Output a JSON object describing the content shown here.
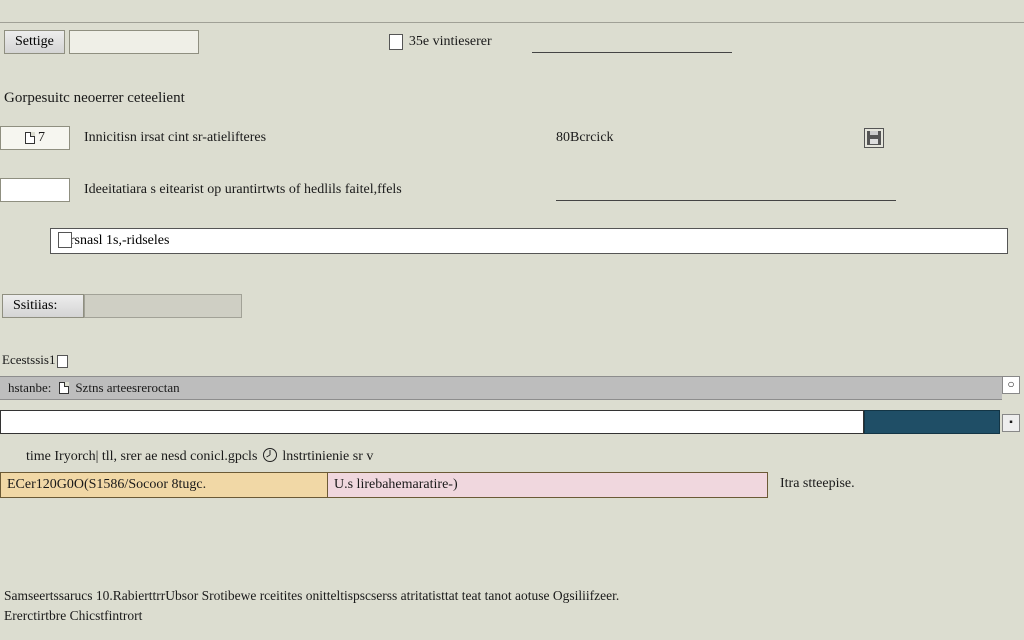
{
  "toolbar": {
    "settings_label": "Settige",
    "view_checkbox_label": "35e vintieserer"
  },
  "section1": {
    "heading": "Gorpesuitc neoerrer ceteelient",
    "row1": {
      "box_value": "7",
      "text": "Innicitisn irsat cint sr-atielifteres",
      "right_label": "80Bcrcick"
    },
    "row2": {
      "text": "Ideeitatiara s eitearist op urantirtwts of hedlils faitel,ffels"
    },
    "row3": {
      "input_value": "farsnasl 1s,-ridseles"
    }
  },
  "section2": {
    "button_label": "Ssitiias:",
    "sub_label": "Ecestssis1",
    "titlebar": {
      "left": "hstanbe:",
      "text": "Sztns arteesreroctan"
    }
  },
  "bottom": {
    "desc": "time Iryorch| tll, srer ae nesd conicl.gpcls",
    "desc_tail": "lnstrtinienie sr v",
    "code_left": "ECer120G0O(S1586/Socoor 8tugc.",
    "code_right": "U.s lirebahemaratire-)",
    "trail": "Itra stteepise."
  },
  "footer": {
    "line1": "Samseertssarucs 10.RabierttrrUbsor Srotibewe rceitites onitteltispscserss atritatisttat teat tanot aotuse Ogsiliifzeer.",
    "line2": "Ererctirtbre Chicstfintrort"
  }
}
